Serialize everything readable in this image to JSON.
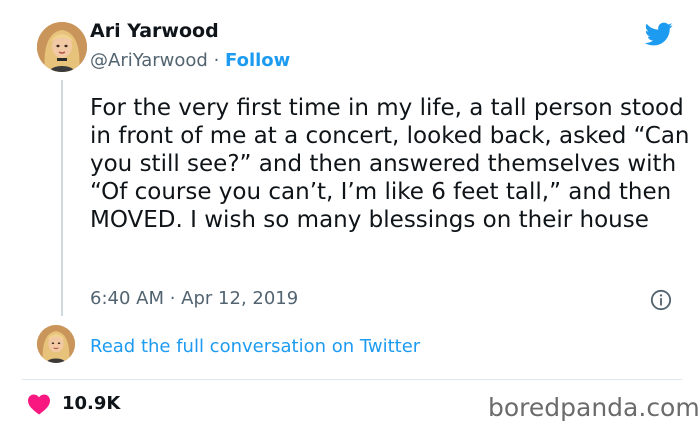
{
  "tweet": {
    "author_name": "Ari Yarwood",
    "handle": "@AriYarwood",
    "separator": " · ",
    "follow_label": "Follow",
    "text": "For the very first time in my life, a tall person stood in front of me at a concert, looked back, asked “Can you still see?” and then answered themselves with “Of course you can’t, I’m like 6 feet tall,” and then MOVED. I wish so many blessings on their house",
    "time": "6:40 AM",
    "date": "Apr 12, 2019",
    "meta_separator": " · ",
    "read_conversation_label": "Read the full conversation on Twitter",
    "likes_count": "10.9K"
  },
  "icons": {
    "brand": "twitter-bird-icon",
    "info": "info-icon",
    "like": "heart-icon"
  },
  "colors": {
    "twitter_blue": "#1d9bf0",
    "heart_red": "#f91880",
    "secondary_text": "#536471"
  },
  "watermark": "boredpanda.com"
}
